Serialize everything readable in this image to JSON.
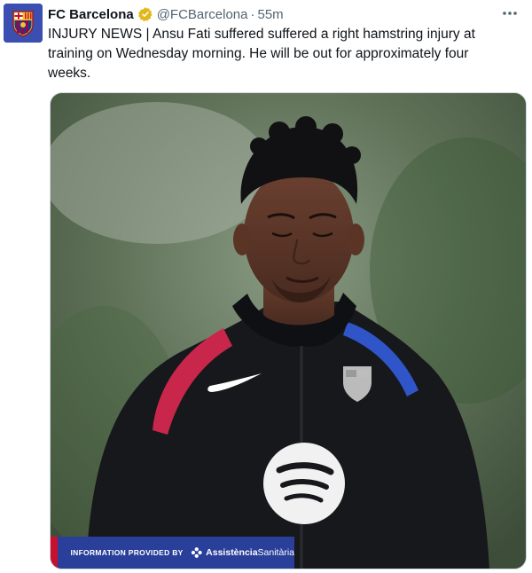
{
  "tweet": {
    "author": {
      "name": "FC Barcelona",
      "handle": "@FCBarcelona",
      "verified": true,
      "avatar_icon": "fc-barcelona-crest-icon"
    },
    "separator": "·",
    "time": "55m",
    "more_icon": "more-options-icon",
    "text": "INJURY NEWS | Ansu Fati suffered suffered a right hamstring injury at training on Wednesday morning. He will be out for approximately four weeks.",
    "media": {
      "banner": {
        "label": "INFORMATION PROVIDED BY",
        "brand_bold": "Assistència",
        "brand_light": "Sanitària"
      }
    }
  },
  "colors": {
    "text": "#0f1419",
    "secondary": "#536471",
    "verified_gold": "#e2b719",
    "banner_blue": "#2a3f9a",
    "banner_red": "#c8102e"
  }
}
